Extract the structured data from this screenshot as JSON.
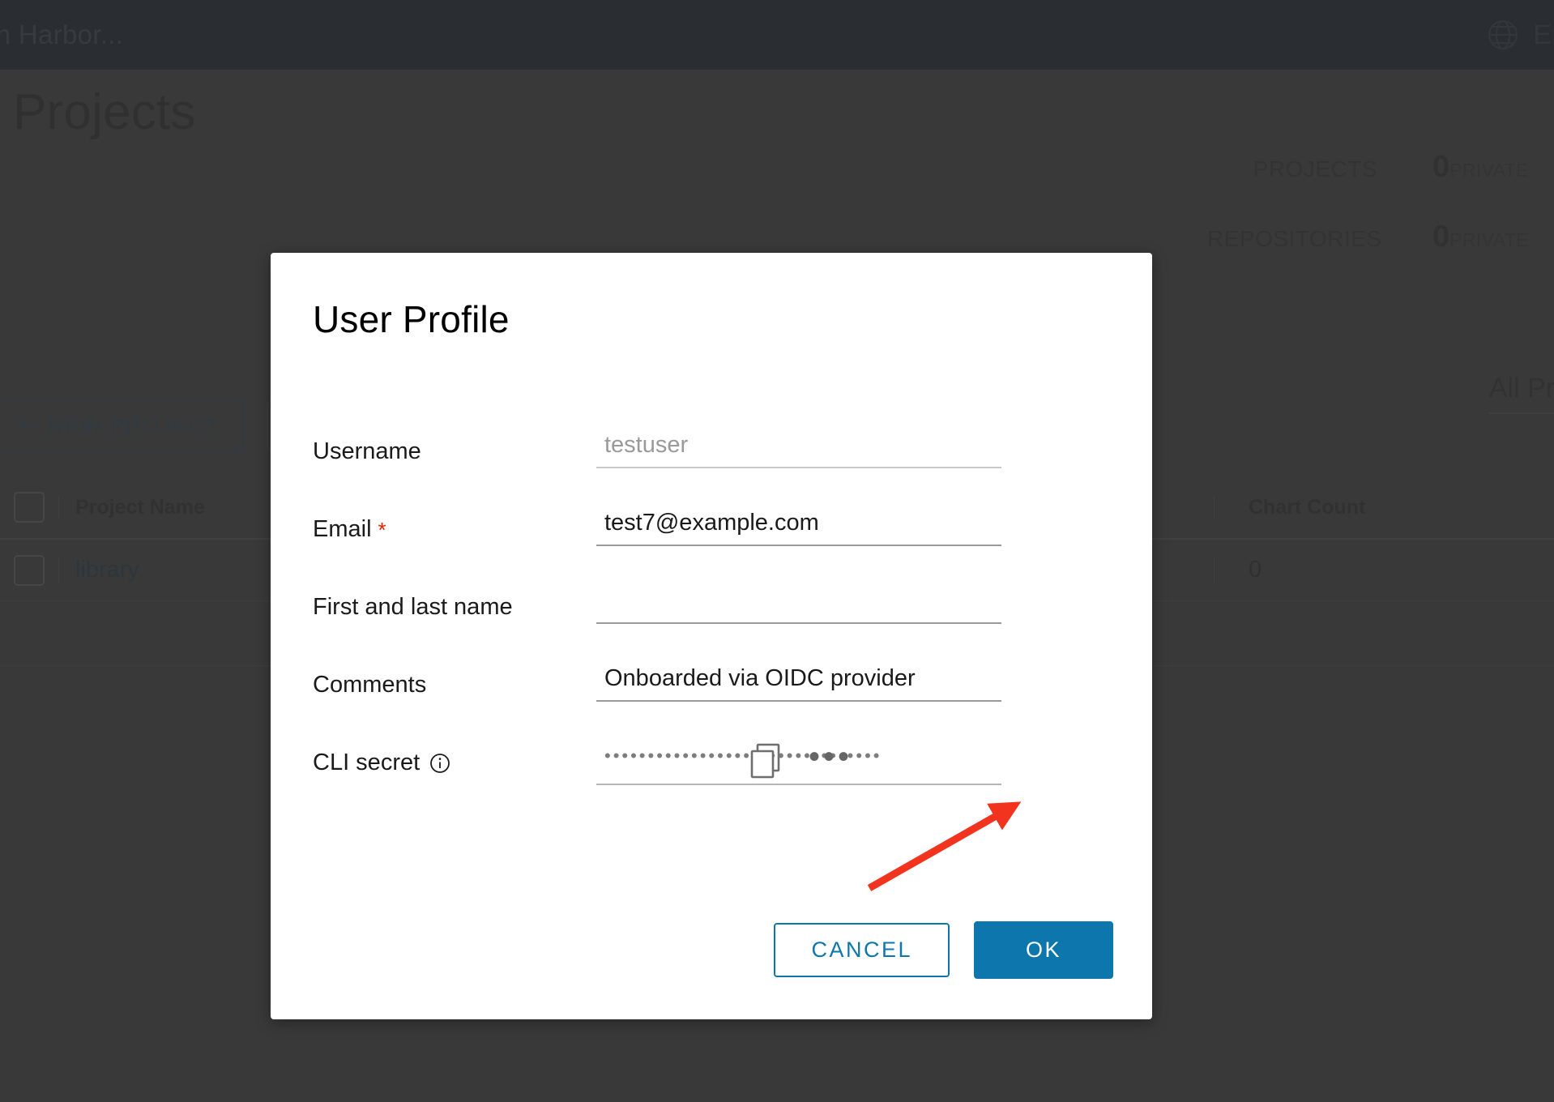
{
  "topbar": {
    "search_placeholder": "ch Harbor...",
    "globe_icon": "globe-icon",
    "language": "En"
  },
  "page": {
    "title": "Projects",
    "filter_label": "All Pro"
  },
  "stats": {
    "rows": [
      {
        "label": "PROJECTS",
        "count": "0",
        "scope": "PRIVATE"
      },
      {
        "label": "REPOSITORIES",
        "count": "0",
        "scope": "PRIVATE"
      }
    ]
  },
  "toolbar": {
    "new_project_label": "NEW PROJECT",
    "plus_icon": "plus-icon",
    "delete_label": "×"
  },
  "table": {
    "headers": {
      "project_name": "Project Name",
      "chart_count": "Chart Count"
    },
    "rows": [
      {
        "name": "library",
        "chart_count": "0"
      }
    ]
  },
  "modal": {
    "title": "User Profile",
    "fields": {
      "username": {
        "label": "Username",
        "value": "",
        "placeholder": "testuser"
      },
      "email": {
        "label": "Email",
        "required_marker": "*",
        "value": "test7@example.com",
        "placeholder": ""
      },
      "fullname": {
        "label": "First and last name",
        "value": "",
        "placeholder": ""
      },
      "comments": {
        "label": "Comments",
        "value": "Onboarded via OIDC provider",
        "placeholder": ""
      },
      "cli_secret": {
        "label": "CLI secret",
        "info_icon": "info-icon",
        "masked_value": "••••••••••••••••••••••••••••••••",
        "copy_icon": "copy-icon",
        "more_actions": "•••"
      }
    },
    "buttons": {
      "cancel": "CANCEL",
      "ok": "OK"
    }
  },
  "colors": {
    "accent_blue": "#0d77ad",
    "topbar_bg": "#2d3742",
    "overlay": "#4d4d4d",
    "required_red": "#e12200",
    "annotation_red": "#f2341f"
  }
}
